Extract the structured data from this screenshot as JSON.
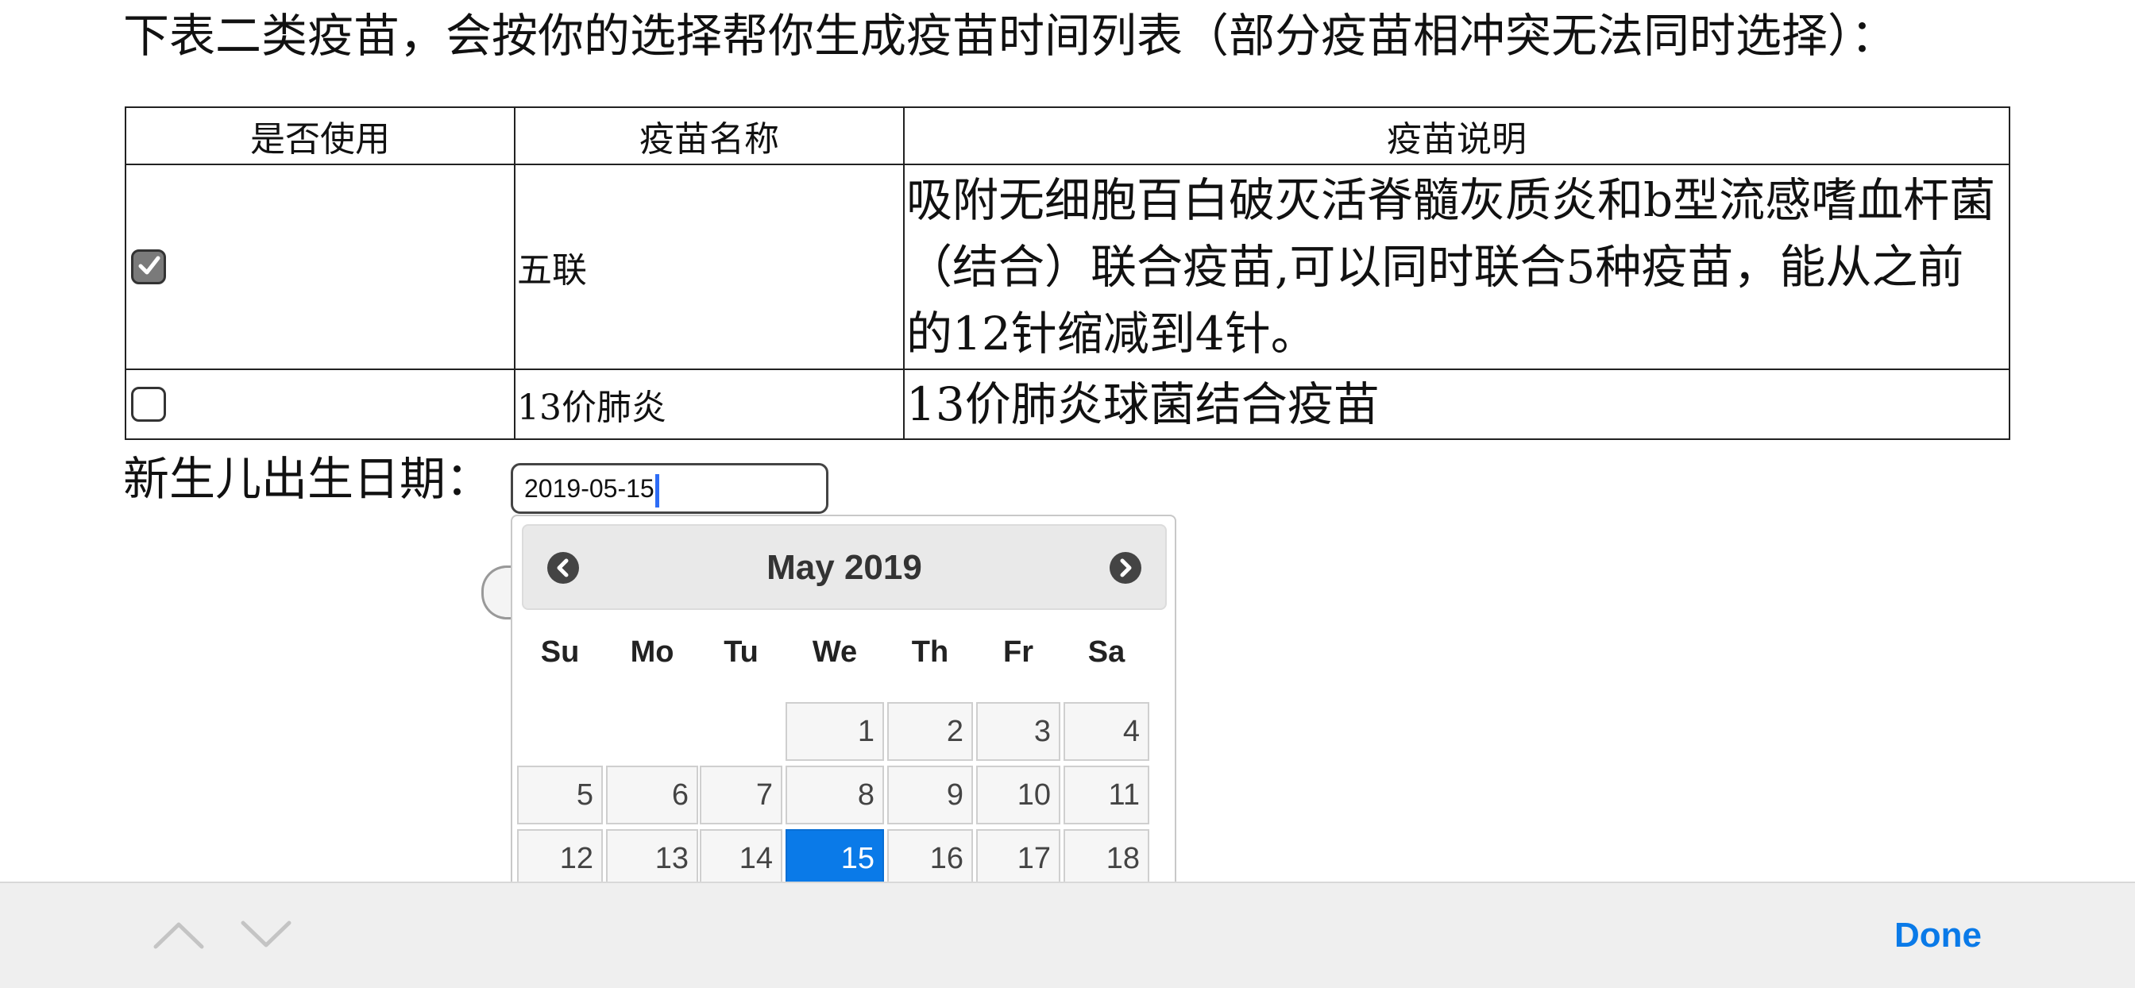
{
  "intro_text": "下表二类疫苗，会按你的选择帮你生成疫苗时间列表（部分疫苗相冲突无法同时选择）：",
  "table": {
    "headers": [
      "是否使用",
      "疫苗名称",
      "疫苗说明"
    ],
    "rows": [
      {
        "checked": true,
        "name": "五联",
        "description": "吸附无细胞百白破灭活脊髓灰质炎和b型流感嗜血杆菌（结合）联合疫苗,可以同时联合5种疫苗，能从之前的12针缩减到4针。"
      },
      {
        "checked": false,
        "name": "13价肺炎",
        "description": "13价肺炎球菌结合疫苗"
      }
    ]
  },
  "birth": {
    "label": "新生儿出生日期：",
    "value": "2019-05-15"
  },
  "datepicker": {
    "title": "May 2019",
    "prev_icon": "chevron-left-icon",
    "next_icon": "chevron-right-icon",
    "weekdays": [
      "Su",
      "Mo",
      "Tu",
      "We",
      "Th",
      "Fr",
      "Sa"
    ],
    "weeks": [
      [
        "",
        "",
        "",
        "1",
        "2",
        "3",
        "4"
      ],
      [
        "5",
        "6",
        "7",
        "8",
        "9",
        "10",
        "11"
      ],
      [
        "12",
        "13",
        "14",
        "15",
        "16",
        "17",
        "18"
      ]
    ],
    "selected": "15",
    "accent": "#0a7ae8"
  },
  "toolbar": {
    "up_icon": "chevron-up-icon",
    "down_icon": "chevron-down-icon",
    "done_label": "Done"
  }
}
